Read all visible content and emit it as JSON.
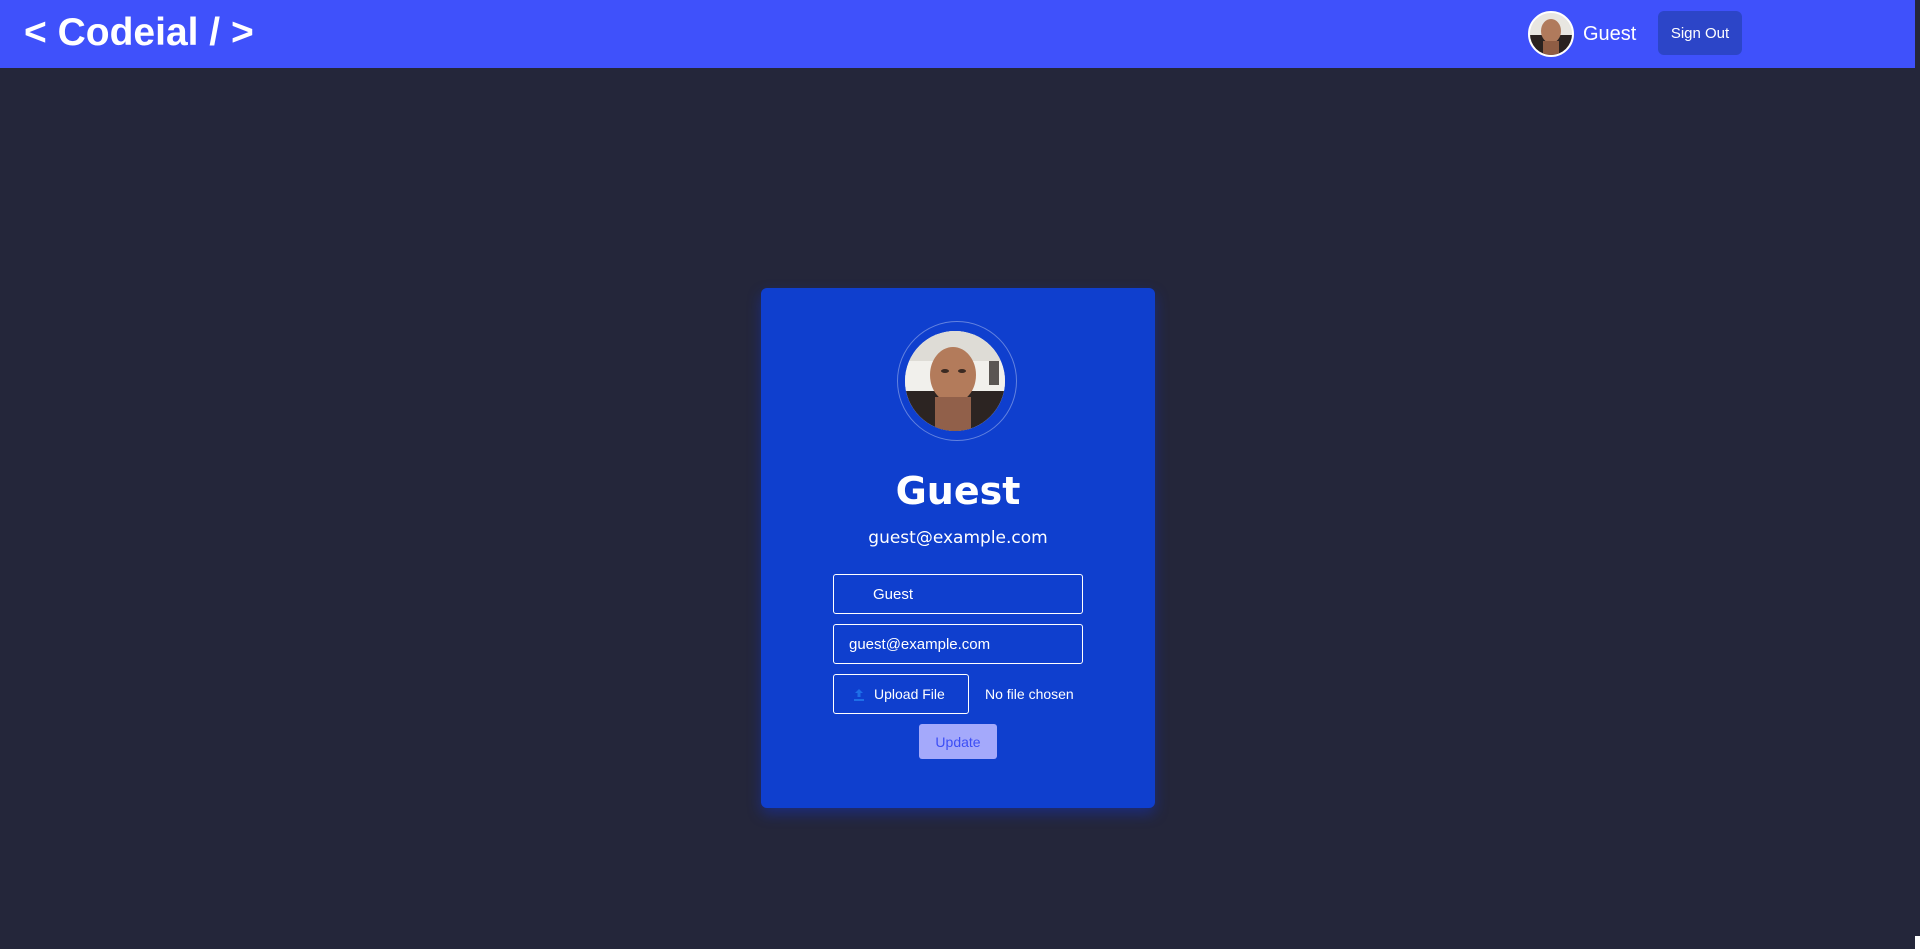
{
  "navbar": {
    "logo": "< Codeial / >",
    "username": "Guest",
    "sign_out_label": "Sign Out"
  },
  "profile": {
    "name": "Guest",
    "email": "guest@example.com",
    "form": {
      "name_value": "Guest",
      "email_value": "guest@example.com",
      "upload_label": "Upload File",
      "file_status": "No file chosen",
      "update_label": "Update"
    }
  },
  "colors": {
    "navbar": "#3f51fb",
    "page_background": "#24263a",
    "card": "#0f3fce",
    "update_button": "#a4a9fb"
  },
  "icons": {
    "upload": "upload-icon",
    "avatar": "user-avatar-photo"
  }
}
